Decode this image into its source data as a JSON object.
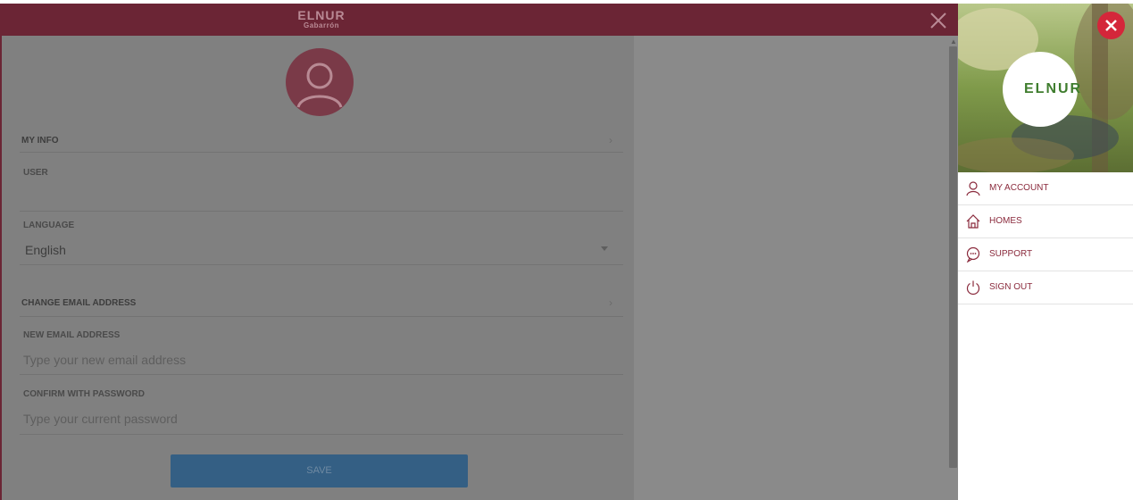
{
  "header": {
    "logo_line1": "ELNUR",
    "logo_line2": "Gabarrón"
  },
  "profile": {
    "my_info_label": "MY INFO",
    "user_label": "USER",
    "user_value": "",
    "language_label": "LANGUAGE",
    "language_value": "English",
    "change_email_label": "CHANGE EMAIL ADDRESS",
    "new_email_label": "NEW EMAIL ADDRESS",
    "new_email_placeholder": "Type your new email address",
    "confirm_password_label": "CONFIRM WITH PASSWORD",
    "confirm_password_placeholder": "Type your current password",
    "save_label": "SAVE"
  },
  "side_menu": {
    "brand": "ELNUR",
    "items": [
      {
        "label": "MY ACCOUNT",
        "icon": "user-icon"
      },
      {
        "label": "HOMES",
        "icon": "home-icon"
      },
      {
        "label": "SUPPORT",
        "icon": "chat-icon"
      },
      {
        "label": "SIGN OUT",
        "icon": "power-icon"
      }
    ]
  },
  "colors": {
    "brand_maroon": "#6b2535",
    "accent_red": "#d4263a",
    "save_blue": "#345f84",
    "brand_green": "#3f7d2e"
  }
}
